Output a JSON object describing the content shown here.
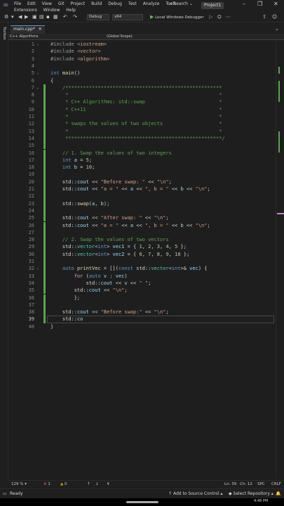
{
  "menu": {
    "row1": [
      "File",
      "Edit",
      "View",
      "Git",
      "Project",
      "Build",
      "Debug",
      "Test",
      "Analyze",
      "Tools"
    ],
    "row2": [
      "Extensions",
      "Window",
      "Help"
    ],
    "search": "Search",
    "project": "Project1"
  },
  "toolbar": {
    "config": "Debug",
    "platform": "x64",
    "run_label": "Local Windows Debugger"
  },
  "toolbox_label": "Toolbox",
  "tab": {
    "label": "main.cpp*"
  },
  "nav": {
    "scope_left": "C++ Algorithms",
    "scope_right": "(Global Scope)"
  },
  "editor": {
    "lines": [
      {
        "n": "1",
        "html": "<span class='inc'>#include</span> <span class='str'>&lt;iostream&gt;</span>"
      },
      {
        "n": "2",
        "html": "<span class='inc'>#include</span> <span class='str'>&lt;vector&gt;</span>"
      },
      {
        "n": "3",
        "html": "<span class='inc'>#include</span> <span class='str'>&lt;algorithm&gt;</span>"
      },
      {
        "n": "4",
        "html": ""
      },
      {
        "n": "5",
        "html": "<span class='kw'>int</span> <span class='fn'>main</span>()"
      },
      {
        "n": "6",
        "html": "{"
      },
      {
        "n": "7",
        "html": "    <span class='cmt'>/*****************************************************</span>"
      },
      {
        "n": "8",
        "html": "     <span class='cmt'>*                                                   *</span>"
      },
      {
        "n": "9",
        "html": "     <span class='cmt'>* C++ Algorithms: std::swap                         *</span>"
      },
      {
        "n": "10",
        "html": "     <span class='cmt'>* C++11                                             *</span>"
      },
      {
        "n": "11",
        "html": "     <span class='cmt'>*                                                   *</span>"
      },
      {
        "n": "12",
        "html": "     <span class='cmt'>* swaps the values of two objects                   *</span>"
      },
      {
        "n": "13",
        "html": "     <span class='cmt'>*                                                   *</span>"
      },
      {
        "n": "14",
        "html": "     <span class='cmt'>*****************************************************/</span>"
      },
      {
        "n": "15",
        "html": ""
      },
      {
        "n": "16",
        "html": "    <span class='cmt'>// 1. Swap the values of two integers</span>"
      },
      {
        "n": "17",
        "html": "    <span class='kw'>int</span> <span class='var'>a</span> = <span class='num'>5</span>;"
      },
      {
        "n": "18",
        "html": "    <span class='kw'>int</span> <span class='var'>b</span> = <span class='num'>10</span>;"
      },
      {
        "n": "19",
        "html": ""
      },
      {
        "n": "20",
        "html": "    std::<span class='var'>cout</span> &lt;&lt; <span class='str'>\"Before swap: \"</span> &lt;&lt; <span class='str'>\"\\n\"</span>;"
      },
      {
        "n": "21",
        "html": "    std::<span class='var'>cout</span> &lt;&lt; <span class='str'>\"a = \"</span> &lt;&lt; <span class='var'>a</span> &lt;&lt; <span class='str'>\", b = \"</span> &lt;&lt; <span class='var'>b</span> &lt;&lt; <span class='str'>\"\\n\"</span>;"
      },
      {
        "n": "22",
        "html": ""
      },
      {
        "n": "23",
        "html": "    std::<span class='fn'>swap</span>(<span class='var'>a</span>, <span class='var'>b</span>);"
      },
      {
        "n": "24",
        "html": ""
      },
      {
        "n": "25",
        "html": "    std::<span class='var'>cout</span> &lt;&lt; <span class='str'>\"After swap: \"</span> &lt;&lt; <span class='str'>\"\\n\"</span>;"
      },
      {
        "n": "26",
        "html": "    std::<span class='var'>cout</span> &lt;&lt; <span class='str'>\"a = \"</span> &lt;&lt; <span class='var'>a</span> &lt;&lt; <span class='str'>\", b = \"</span> &lt;&lt; <span class='var'>b</span> &lt;&lt; <span class='str'>\"\\n\"</span>;"
      },
      {
        "n": "27",
        "html": ""
      },
      {
        "n": "28",
        "html": "    <span class='cmt'>// 2. Swap the values of two vectors</span>"
      },
      {
        "n": "29",
        "html": "    std::<span class='ty'>vector</span>&lt;<span class='kw'>int</span>&gt; <span class='var'>vec1</span> = { <span class='num'>1</span>, <span class='num'>2</span>, <span class='num'>3</span>, <span class='num'>4</span>, <span class='num'>5</span> };"
      },
      {
        "n": "30",
        "html": "    std::<span class='ty'>vector</span>&lt;<span class='kw'>int</span>&gt; <span class='var'>vec2</span> = { <span class='num'>6</span>, <span class='num'>7</span>, <span class='num'>8</span>, <span class='num'>9</span>, <span class='num'>10</span> };"
      },
      {
        "n": "31",
        "html": ""
      },
      {
        "n": "32",
        "html": "    <span class='kw'>auto</span> <span class='fn'>printVec</span> = [](<span class='kw'>const</span> std::<span class='ty'>vector</span>&lt;<span class='kw'>int</span>&gt;&amp; <span class='var'>vec</span>) {"
      },
      {
        "n": "33",
        "html": "        <span class='ctl'>for</span> (<span class='kw'>auto</span> <span class='var'>v</span> : <span class='var'>vec</span>)"
      },
      {
        "n": "34",
        "html": "            std::<span class='var'>cout</span> &lt;&lt; <span class='var'>v</span> &lt;&lt; <span class='str'>\" \"</span>;"
      },
      {
        "n": "35",
        "html": "        std::<span class='var'>cout</span> &lt;&lt; <span class='str'>\"\\n\"</span>;"
      },
      {
        "n": "36",
        "html": "        };"
      },
      {
        "n": "37",
        "html": ""
      },
      {
        "n": "38",
        "html": "    std::<span class='var'>cout</span> &lt;&lt; <span class='str'>\"Before swap:\"</span> &lt;&lt; <span class='str'>\"\\n\"</span>;"
      },
      {
        "n": "39",
        "html": "    std::<span class='var'>co</span>"
      },
      {
        "n": "40",
        "html": "}"
      }
    ],
    "active_line": "39",
    "modified_lines": [
      "7",
      "8",
      "9",
      "10",
      "11",
      "12",
      "13",
      "14",
      "15",
      "16",
      "17",
      "18",
      "19",
      "20",
      "21",
      "22",
      "23",
      "24",
      "25",
      "26",
      "27",
      "28",
      "29",
      "30",
      "31",
      "32",
      "33",
      "34",
      "35",
      "36",
      "37",
      "38",
      "39"
    ]
  },
  "editor_status": {
    "zoom": "129 %",
    "errors": "1",
    "warnings": "0",
    "line": "Ln: 39",
    "col": "Ch: 12",
    "mode": "SPC",
    "eol": "CRLF"
  },
  "statusbar": {
    "ready": "Ready",
    "source_control": "Add to Source Control",
    "repository": "Select Repository",
    "time": "4:48 PM"
  }
}
